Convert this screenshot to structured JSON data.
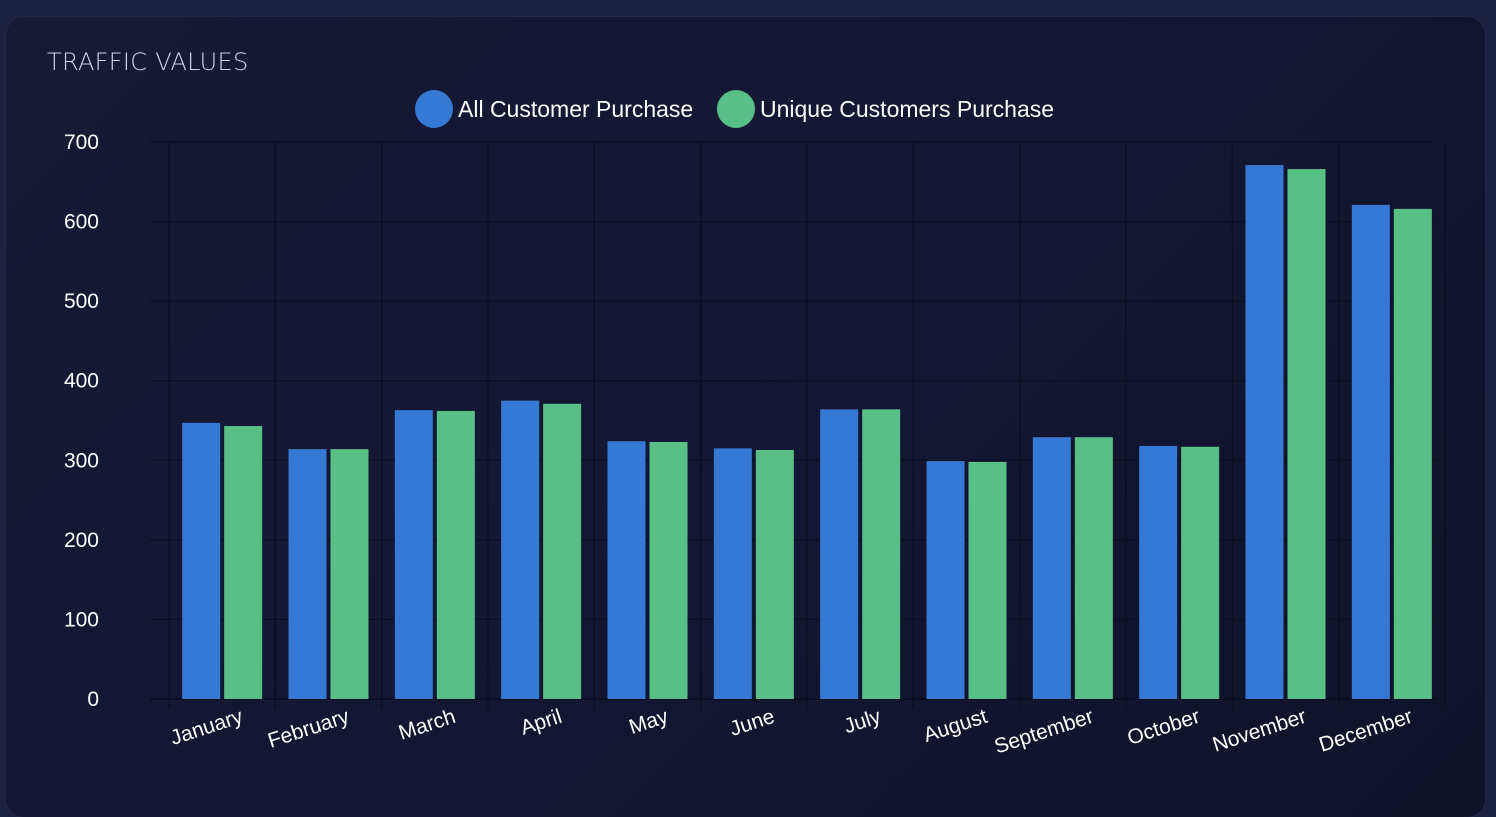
{
  "card": {
    "title": "TRAFFIC VALUES"
  },
  "colors": {
    "background": "#1c2142",
    "card": "#151933",
    "grid": "#0b0d20",
    "text": "#ffffff",
    "series_1": "#3679d4",
    "series_2": "#58c086"
  },
  "chart_data": {
    "type": "bar",
    "title": "",
    "xlabel": "",
    "ylabel": "",
    "ylim": [
      0,
      700
    ],
    "y_ticks": [
      0,
      100,
      200,
      300,
      400,
      500,
      600,
      700
    ],
    "grid": true,
    "legend_position": "top-center",
    "categories": [
      "January",
      "February",
      "March",
      "April",
      "May",
      "June",
      "July",
      "August",
      "September",
      "October",
      "November",
      "December"
    ],
    "series": [
      {
        "name": "All Customer Purchase",
        "color": "#3679d4",
        "values": [
          347,
          314,
          363,
          375,
          324,
          315,
          364,
          299,
          329,
          318,
          671,
          621
        ]
      },
      {
        "name": "Unique Customers Purchase",
        "color": "#58c086",
        "values": [
          343,
          314,
          362,
          371,
          323,
          313,
          364,
          298,
          329,
          317,
          666,
          616
        ]
      }
    ]
  }
}
